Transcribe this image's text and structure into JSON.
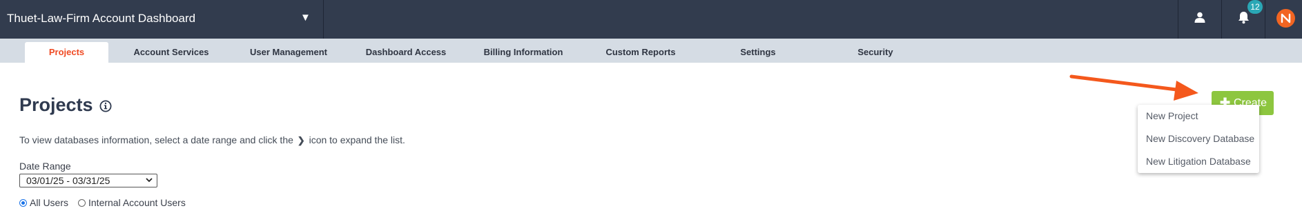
{
  "header": {
    "account_title": "Thuet-Law-Firm Account Dashboard",
    "account_caret": "▼",
    "notifications_count": "12"
  },
  "tabs": [
    {
      "label": "Projects",
      "active": true
    },
    {
      "label": "Account Services"
    },
    {
      "label": "User Management"
    },
    {
      "label": "Dashboard Access"
    },
    {
      "label": "Billing Information"
    },
    {
      "label": "Custom Reports"
    },
    {
      "label": "Settings"
    },
    {
      "label": "Security"
    }
  ],
  "main": {
    "title": "Projects",
    "instructions_before": "To view databases information, select a date range and click the",
    "instructions_chevron": "❯",
    "instructions_after": "icon to expand the list.",
    "date_range_label": "Date Range",
    "date_range_value": "03/01/25 - 03/31/25",
    "date_range_caret": "⌄",
    "radio_all_users": "All Users",
    "radio_internal_users": "Internal Account Users",
    "selected_radio": "All Users"
  },
  "create": {
    "plus": "✚",
    "label": "Create",
    "menu": [
      "New Project",
      "New Discovery Database",
      "New Litigation Database"
    ]
  },
  "colors": {
    "topbar": "#323c4e",
    "tabbar": "#d5dce4",
    "active_tab_text": "#ef4a23",
    "create_button": "#8dc63f",
    "notification_badge": "#2aa7b5",
    "brand": "#f26522",
    "annotation_arrow": "#f4581c"
  },
  "icons": {
    "user": "user-icon",
    "bell": "bell-icon",
    "brand": "brand-logo-icon",
    "info": "info-icon"
  }
}
